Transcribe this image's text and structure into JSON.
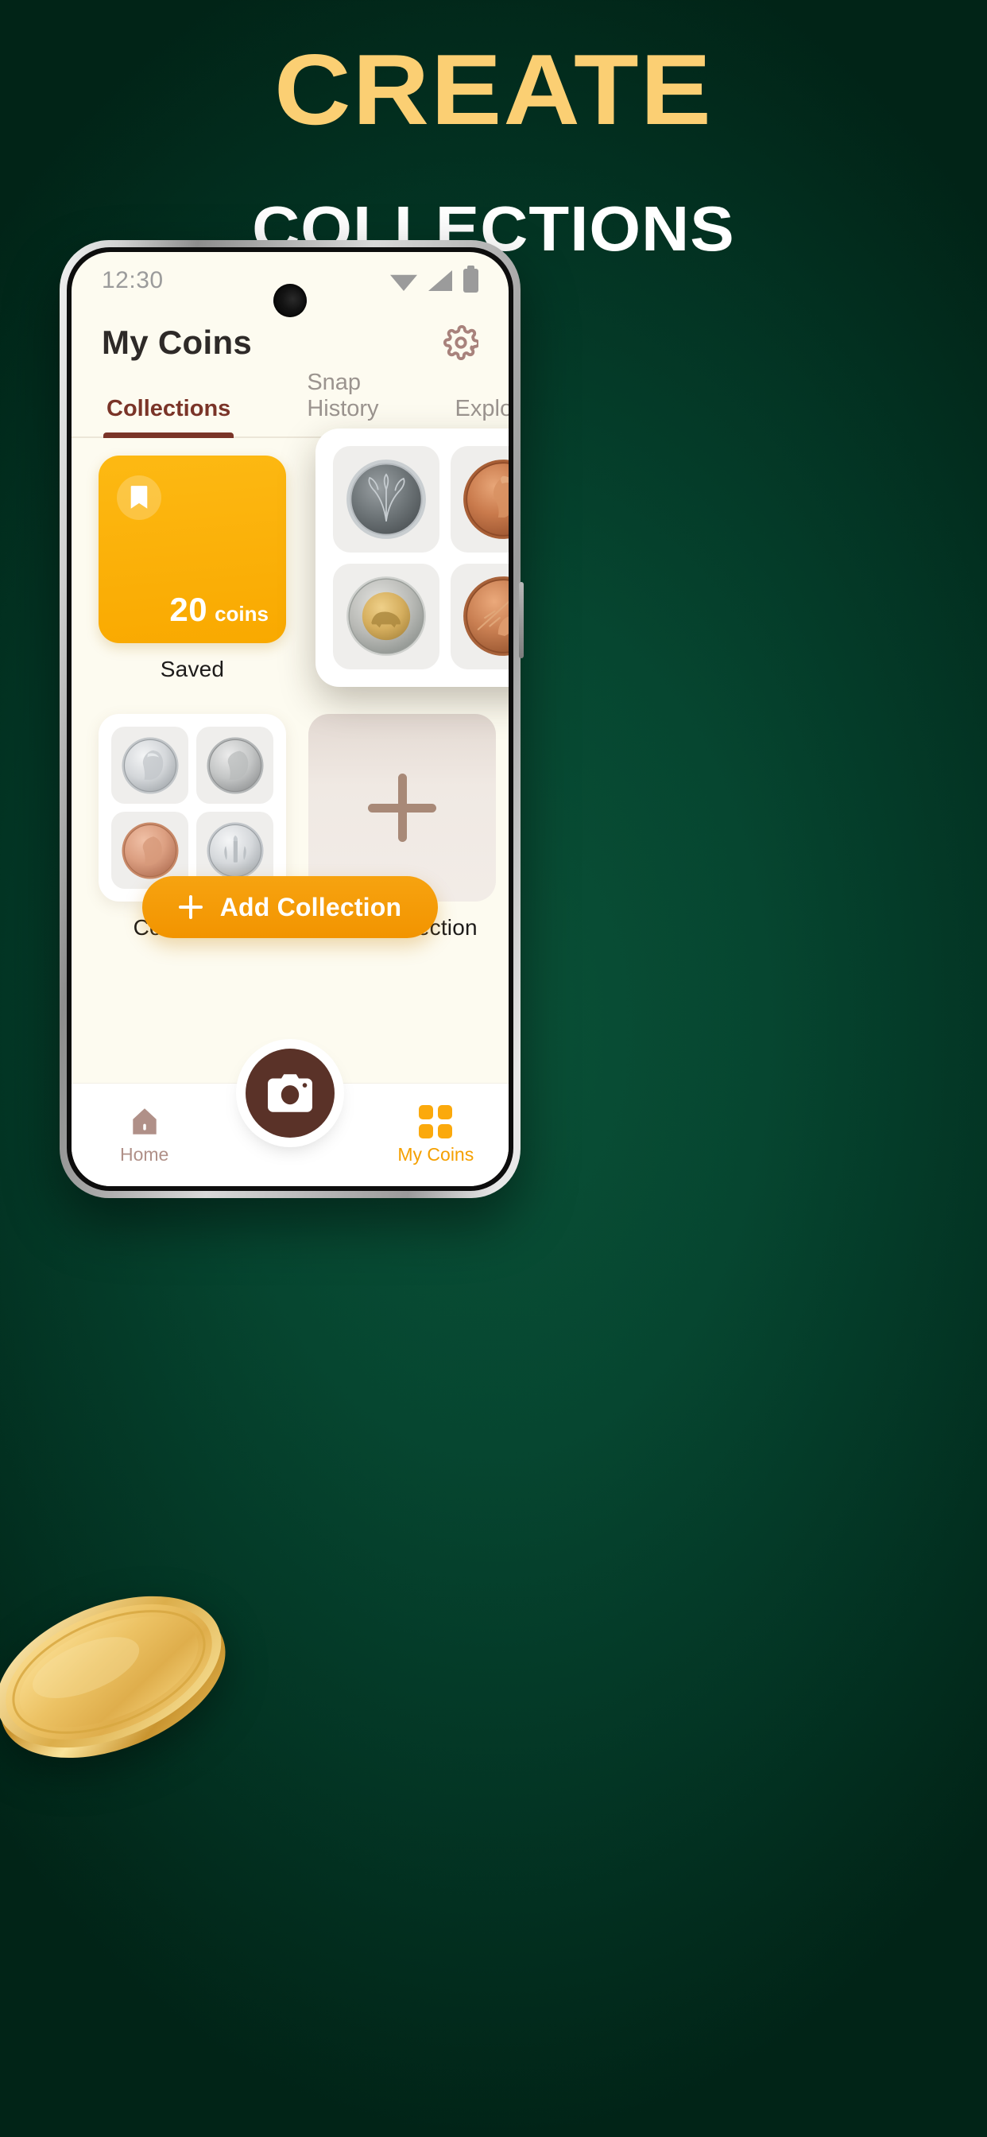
{
  "promo": {
    "line1": "CREATE",
    "line2": "COLLECTIONS",
    "accent_color": "#FBCF73",
    "background_color": "#064630"
  },
  "phone": {
    "statusbar": {
      "time": "12:30",
      "icons": [
        "wifi-icon",
        "cellular-signal-icon",
        "battery-icon"
      ],
      "icon_color": "#9B9B9B"
    },
    "appbar": {
      "title": "My Coins",
      "settings_icon": "gear-icon",
      "settings_icon_color": "#A8827C"
    },
    "tabs": [
      {
        "label": "Collections",
        "active": true
      },
      {
        "label": "Snap History",
        "active": false
      },
      {
        "label": "Explore",
        "active": false
      }
    ],
    "tab_active_color": "#7A3428",
    "tab_inactive_color": "#9B948F",
    "collections": [
      {
        "name": "Saved",
        "type": "saved",
        "icon": "bookmark-icon",
        "count": "20",
        "count_unit": "coins",
        "color": "#FBB108"
      },
      {
        "name": "Collection 1",
        "type": "coin-grid",
        "coins": [
          "roosevelt-dime-2017-d-obverse",
          "eisenhower-dollar-1973-obverse",
          "lincoln-cent-2021-s-obverse",
          "roosevelt-dime-reverse-one-dime"
        ]
      },
      {
        "name": "New Collection",
        "type": "new",
        "icon": "plus-icon"
      }
    ],
    "floating_card": {
      "coins": [
        "china-zhongguo-renmin-yinhang-orchid-jiao",
        "cayman-islands-1972-elizabeth-ii-cent",
        "canada-2-dollars-polar-bear-toonie",
        "copper-one-cent-bird-bamboo"
      ]
    },
    "add_button": {
      "label": "Add Collection",
      "icon": "plus-icon",
      "color": "#F59A0B"
    },
    "bottom_nav": [
      {
        "label": "Home",
        "icon": "home-icon",
        "active": false
      },
      {
        "label": "",
        "icon": "camera-icon",
        "active": false
      },
      {
        "label": "My Coins",
        "icon": "grid-icon",
        "active": true
      }
    ],
    "nav_active_color": "#F5A000",
    "nav_inactive_color": "#B09088",
    "camera_fab_color": "#5A3228"
  },
  "decoration": {
    "gold_coin": "gold-coin-illustration"
  }
}
